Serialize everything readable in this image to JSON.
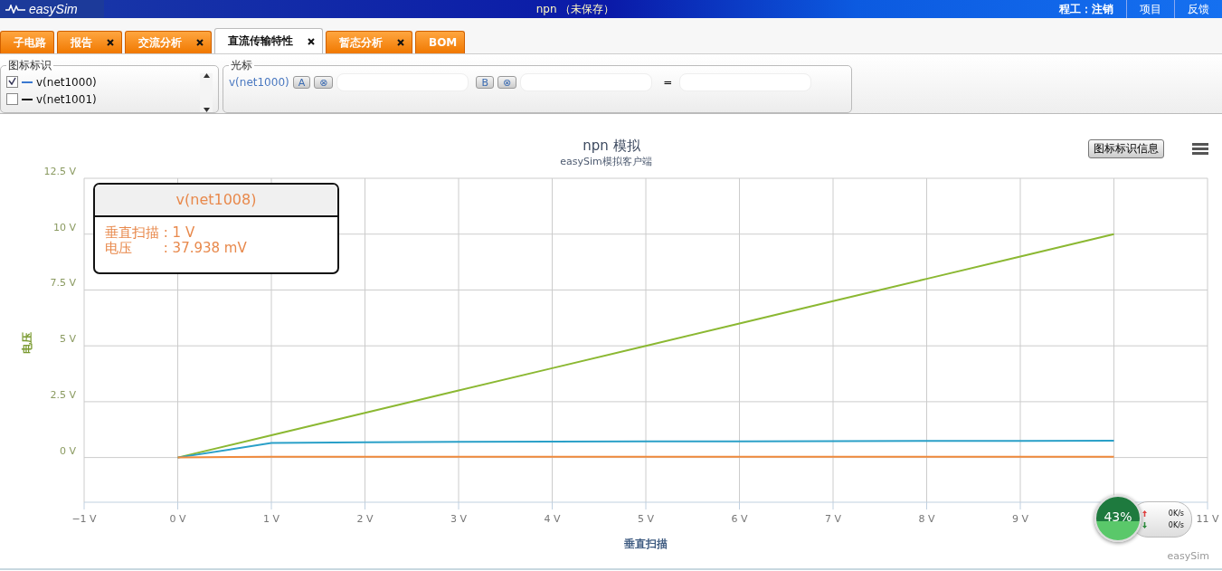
{
  "header": {
    "logo": "easySim",
    "title": "npn （未保存）",
    "account": "程工：注销",
    "links": [
      "项目",
      "反馈"
    ]
  },
  "tabs": [
    {
      "label": "子电路",
      "selected": false,
      "closable": false
    },
    {
      "label": "报告",
      "selected": false,
      "closable": true
    },
    {
      "label": "交流分析",
      "selected": false,
      "closable": true
    },
    {
      "label": "直流传输特性",
      "selected": true,
      "closable": true
    },
    {
      "label": "暂态分析",
      "selected": false,
      "closable": true
    },
    {
      "label": "BOM",
      "selected": false,
      "closable": false
    }
  ],
  "legend_panel": {
    "title": "图标标识",
    "items": [
      {
        "label": "v(net1000)",
        "checked": true,
        "color": "#3a78d0"
      },
      {
        "label": "v(net1001)",
        "checked": false,
        "color": "#111111"
      }
    ]
  },
  "cursor_panel": {
    "title": "光标",
    "signal": "v(net1000)",
    "cursors": [
      {
        "label": "A",
        "clear": "⊗"
      },
      {
        "label": "B",
        "clear": "⊗"
      }
    ],
    "equals": "="
  },
  "chart": {
    "legend_button": "图标标识信息",
    "credit": "easySim",
    "tooltip": {
      "title": "v(net1008)",
      "lines": [
        "垂直扫描 : 1 V",
        "电压　　 : 37.938 mV"
      ]
    },
    "chart_data": {
      "type": "line",
      "title": "npn 模拟",
      "subtitle": "easySim模拟客户端",
      "xlabel": "垂直扫描",
      "ylabel": "电压",
      "x": [
        0,
        1,
        2,
        3,
        4,
        5,
        6,
        7,
        8,
        9,
        10
      ],
      "series": [
        {
          "color": "#8bb832",
          "values": [
            0,
            1,
            2,
            3,
            4,
            5,
            6,
            7,
            8,
            9,
            10
          ]
        },
        {
          "color": "#2aa0c8",
          "values": [
            0,
            0.65,
            0.68,
            0.7,
            0.71,
            0.72,
            0.72,
            0.73,
            0.74,
            0.74,
            0.75
          ]
        },
        {
          "color": "#f08a3c",
          "values": [
            0,
            0.04,
            0.04,
            0.04,
            0.04,
            0.04,
            0.04,
            0.04,
            0.04,
            0.04,
            0.04
          ]
        }
      ],
      "grid": true,
      "xlim": [
        -1,
        11
      ],
      "ylim": [
        -2,
        12.5
      ],
      "xticks": [
        {
          "value": -1,
          "label": "−1 V"
        },
        {
          "value": 0,
          "label": "0 V"
        },
        {
          "value": 1,
          "label": "1 V"
        },
        {
          "value": 2,
          "label": "2 V"
        },
        {
          "value": 3,
          "label": "3 V"
        },
        {
          "value": 4,
          "label": "4 V"
        },
        {
          "value": 5,
          "label": "5 V"
        },
        {
          "value": 6,
          "label": "6 V"
        },
        {
          "value": 7,
          "label": "7 V"
        },
        {
          "value": 8,
          "label": "8 V"
        },
        {
          "value": 9,
          "label": "9 V"
        },
        {
          "value": 11,
          "label": "11 V"
        }
      ],
      "yticks": [
        {
          "value": 0,
          "label": "0 V"
        },
        {
          "value": 2.5,
          "label": "2.5 V"
        },
        {
          "value": 5,
          "label": "5 V"
        },
        {
          "value": 7.5,
          "label": "7.5 V"
        },
        {
          "value": 10,
          "label": "10 V"
        },
        {
          "value": 12.5,
          "label": "12.5 V"
        }
      ]
    }
  },
  "net_meter": {
    "percent": "43%",
    "up": "0K/s",
    "down": "0K/s"
  }
}
